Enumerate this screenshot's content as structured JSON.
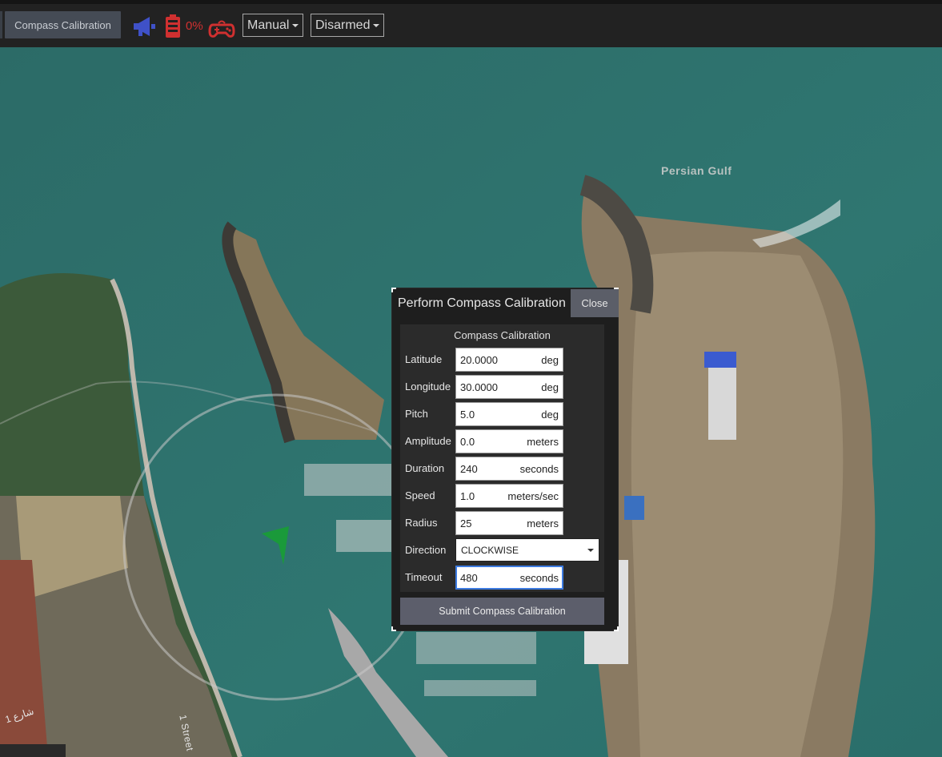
{
  "toolbar": {
    "compass_button_label": "Compass Calibration",
    "battery_percent": "0%",
    "mode_select": "Manual",
    "arm_select": "Disarmed",
    "icons": [
      "megaphone-icon",
      "battery-icon",
      "gamepad-icon"
    ],
    "colors": {
      "megaphone": "#3f51c8",
      "battery": "#d03030",
      "gamepad": "#d03030"
    }
  },
  "map": {
    "labels": {
      "sea": "Persian Gulf",
      "street": "1 Street",
      "street_ar": "شارع 1"
    },
    "vehicle_color": "#1a9a3a"
  },
  "dialog": {
    "title": "Perform Compass Calibration",
    "close_label": "Close",
    "section_title": "Compass Calibration",
    "fields": [
      {
        "label": "Latitude",
        "value": "20.0000",
        "unit": "deg"
      },
      {
        "label": "Longitude",
        "value": "30.0000",
        "unit": "deg"
      },
      {
        "label": "Pitch",
        "value": "5.0",
        "unit": "deg"
      },
      {
        "label": "Amplitude",
        "value": "0.0",
        "unit": "meters"
      },
      {
        "label": "Duration",
        "value": "240",
        "unit": "seconds"
      },
      {
        "label": "Speed",
        "value": "1.0",
        "unit": "meters/sec"
      },
      {
        "label": "Radius",
        "value": "25",
        "unit": "meters"
      },
      {
        "label": "Direction",
        "value": "CLOCKWISE",
        "unit": ""
      },
      {
        "label": "Timeout",
        "value": "480",
        "unit": "seconds"
      }
    ],
    "submit_label": "Submit Compass Calibration"
  }
}
